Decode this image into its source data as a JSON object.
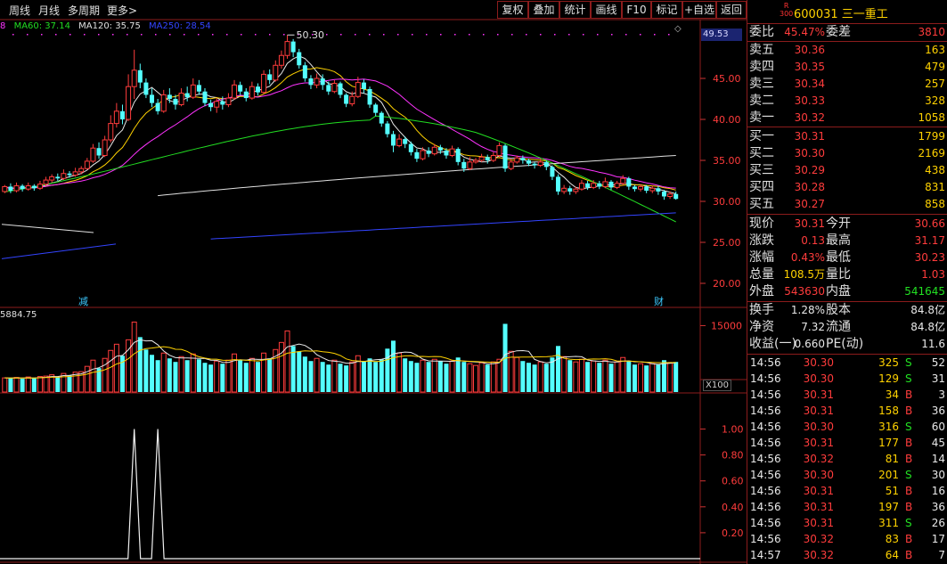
{
  "toolbar": {
    "left_items": [
      "周线",
      "月线",
      "多周期",
      "更多>"
    ],
    "buttons": [
      "复权",
      "叠加",
      "统计",
      "画线",
      "F10",
      "标记",
      "+自选",
      "返回"
    ]
  },
  "ma_legend": [
    {
      "text": "8",
      "color": "#ff33ff"
    },
    {
      "text": "MA60: 37.14",
      "color": "#22dd22"
    },
    {
      "text": "MA120: 35.75",
      "color": "#e0e0e0"
    },
    {
      "text": "MA250: 28.54",
      "color": "#3344ff"
    }
  ],
  "price_chart": {
    "current_price_badge": "49.53",
    "high_label": "50.30",
    "y_ticks": [
      "45.00",
      "40.00",
      "35.00",
      "30.00",
      "25.00",
      "20.00"
    ],
    "markers": [
      "减",
      "财"
    ]
  },
  "volume_chart": {
    "label": "5884.75",
    "y_tick": "15000",
    "unit": "X100"
  },
  "indicator_chart": {
    "y_ticks": [
      "1.00",
      "0.80",
      "0.60",
      "0.40",
      "0.20"
    ]
  },
  "quote_panel": {
    "r_badge": "R",
    "r_badge_sub": "300",
    "title": "600031 三一重工",
    "weibi": {
      "label": "委比",
      "value": "45.47%",
      "label2": "委差",
      "value2": "3810"
    },
    "asks": [
      {
        "label": "卖五",
        "price": "30.36",
        "vol": "163"
      },
      {
        "label": "卖四",
        "price": "30.35",
        "vol": "479"
      },
      {
        "label": "卖三",
        "price": "30.34",
        "vol": "257"
      },
      {
        "label": "卖二",
        "price": "30.33",
        "vol": "328"
      },
      {
        "label": "卖一",
        "price": "30.32",
        "vol": "1058"
      }
    ],
    "bids": [
      {
        "label": "买一",
        "price": "30.31",
        "vol": "1799"
      },
      {
        "label": "买二",
        "price": "30.30",
        "vol": "2169"
      },
      {
        "label": "买三",
        "price": "30.29",
        "vol": "438"
      },
      {
        "label": "买四",
        "price": "30.28",
        "vol": "831"
      },
      {
        "label": "买五",
        "price": "30.27",
        "vol": "858"
      }
    ],
    "stats": [
      {
        "l1": "现价",
        "v1": "30.31",
        "c1": "red",
        "l2": "今开",
        "v2": "30.66",
        "c2": "red"
      },
      {
        "l1": "涨跌",
        "v1": "0.13",
        "c1": "red",
        "l2": "最高",
        "v2": "31.17",
        "c2": "red"
      },
      {
        "l1": "涨幅",
        "v1": "0.43%",
        "c1": "red",
        "l2": "最低",
        "v2": "30.23",
        "c2": "red"
      },
      {
        "l1": "总量",
        "v1": "108.5万",
        "c1": "yellow",
        "l2": "量比",
        "v2": "1.03",
        "c2": "red"
      },
      {
        "l1": "外盘",
        "v1": "543630",
        "c1": "red",
        "l2": "内盘",
        "v2": "541645",
        "c2": "green"
      }
    ],
    "stats2": [
      {
        "l1": "换手",
        "v1": "1.28%",
        "c1": "white",
        "l2": "股本",
        "v2": "84.8亿",
        "c2": "white"
      },
      {
        "l1": "净资",
        "v1": "7.32",
        "c1": "white",
        "l2": "流通",
        "v2": "84.8亿",
        "c2": "white"
      },
      {
        "l1": "收益(一)",
        "v1": "0.660",
        "c1": "white",
        "l2": "PE(动)",
        "v2": "11.6",
        "c2": "white"
      }
    ],
    "ticks": [
      {
        "time": "14:56",
        "price": "30.30",
        "vol": "325",
        "bs": "S",
        "n": "52"
      },
      {
        "time": "14:56",
        "price": "30.30",
        "vol": "129",
        "bs": "S",
        "n": "31"
      },
      {
        "time": "14:56",
        "price": "30.31",
        "vol": "34",
        "bs": "B",
        "n": "3"
      },
      {
        "time": "14:56",
        "price": "30.31",
        "vol": "158",
        "bs": "B",
        "n": "36"
      },
      {
        "time": "14:56",
        "price": "30.30",
        "vol": "316",
        "bs": "S",
        "n": "60"
      },
      {
        "time": "14:56",
        "price": "30.31",
        "vol": "177",
        "bs": "B",
        "n": "45"
      },
      {
        "time": "14:56",
        "price": "30.32",
        "vol": "81",
        "bs": "B",
        "n": "14"
      },
      {
        "time": "14:56",
        "price": "30.30",
        "vol": "201",
        "bs": "S",
        "n": "30"
      },
      {
        "time": "14:56",
        "price": "30.31",
        "vol": "51",
        "bs": "B",
        "n": "16"
      },
      {
        "time": "14:56",
        "price": "30.31",
        "vol": "197",
        "bs": "B",
        "n": "36"
      },
      {
        "time": "14:56",
        "price": "30.31",
        "vol": "311",
        "bs": "S",
        "n": "26"
      },
      {
        "time": "14:56",
        "price": "30.32",
        "vol": "83",
        "bs": "B",
        "n": "17"
      },
      {
        "time": "14:57",
        "price": "30.32",
        "vol": "64",
        "bs": "B",
        "n": "7"
      }
    ]
  },
  "colors": {
    "up": "#ff3c3c",
    "down": "#54ffff",
    "ma5": "#e8e8e8",
    "ma10": "#ffd200",
    "ma20": "#ff33ff",
    "ma60": "#22dd22",
    "ma120": "#e0e0e0",
    "ma250": "#3344ff",
    "border": "#8b1c1c"
  },
  "chart_data": {
    "type": "candlestick",
    "price_y_ticks": [
      45,
      40,
      35,
      30,
      25,
      20
    ],
    "candles": [
      [
        31.2,
        31.8,
        31.0,
        32.0
      ],
      [
        31.8,
        31.3,
        31.0,
        32.2
      ],
      [
        31.3,
        31.9,
        31.1,
        32.3
      ],
      [
        31.9,
        31.5,
        31.2,
        32.1
      ],
      [
        31.5,
        31.9,
        31.3,
        32.3
      ],
      [
        31.9,
        31.6,
        31.3,
        32.1
      ],
      [
        31.6,
        32.1,
        31.4,
        32.5
      ],
      [
        32.1,
        32.6,
        31.9,
        33.0
      ],
      [
        32.6,
        33.0,
        32.3,
        33.3
      ],
      [
        33.0,
        32.8,
        32.5,
        33.4
      ],
      [
        32.8,
        33.4,
        32.6,
        33.9
      ],
      [
        33.4,
        33.2,
        32.9,
        33.7
      ],
      [
        33.2,
        33.6,
        33.0,
        34.1
      ],
      [
        33.6,
        34.0,
        33.3,
        34.3
      ],
      [
        34.0,
        34.9,
        33.9,
        35.3
      ],
      [
        34.9,
        36.5,
        34.7,
        37.0
      ],
      [
        36.5,
        35.6,
        35.2,
        37.2
      ],
      [
        35.6,
        37.5,
        35.4,
        38.0
      ],
      [
        37.5,
        39.5,
        37.2,
        40.5
      ],
      [
        39.5,
        41.0,
        39.0,
        42.0
      ],
      [
        41.0,
        40.0,
        39.4,
        41.8
      ],
      [
        40.0,
        44.0,
        39.8,
        45.5
      ],
      [
        44.0,
        46.0,
        42.5,
        48.5
      ],
      [
        46.0,
        44.5,
        43.8,
        46.8
      ],
      [
        44.5,
        43.0,
        42.6,
        45.0
      ],
      [
        43.0,
        42.0,
        41.5,
        43.8
      ],
      [
        42.0,
        41.0,
        40.6,
        42.5
      ],
      [
        41.0,
        43.0,
        40.8,
        43.6
      ],
      [
        43.0,
        42.5,
        42.0,
        43.8
      ],
      [
        42.5,
        41.8,
        41.2,
        43.0
      ],
      [
        41.8,
        43.2,
        41.6,
        43.8
      ],
      [
        43.2,
        42.7,
        42.2,
        44.0
      ],
      [
        42.7,
        44.2,
        42.5,
        45.0
      ],
      [
        44.2,
        43.4,
        43.0,
        44.8
      ],
      [
        43.4,
        42.0,
        41.6,
        43.8
      ],
      [
        42.0,
        41.5,
        41.0,
        42.4
      ],
      [
        41.5,
        42.2,
        40.8,
        42.6
      ],
      [
        42.2,
        41.8,
        41.2,
        42.8
      ],
      [
        41.8,
        42.6,
        41.5,
        43.2
      ],
      [
        42.6,
        44.2,
        42.4,
        44.8
      ],
      [
        44.2,
        43.4,
        43.0,
        44.6
      ],
      [
        43.4,
        42.6,
        42.2,
        43.8
      ],
      [
        42.6,
        44.0,
        42.4,
        44.6
      ],
      [
        44.0,
        43.3,
        42.9,
        44.4
      ],
      [
        43.3,
        45.5,
        43.1,
        46.0
      ],
      [
        45.5,
        44.8,
        44.3,
        46.1
      ],
      [
        44.8,
        46.6,
        44.6,
        47.2
      ],
      [
        46.6,
        47.8,
        46.2,
        48.4
      ],
      [
        47.8,
        49.5,
        47.4,
        50.3
      ],
      [
        49.5,
        48.2,
        47.6,
        49.8
      ],
      [
        48.2,
        46.6,
        46.2,
        48.6
      ],
      [
        46.6,
        45.0,
        44.6,
        47.0
      ],
      [
        45.0,
        44.2,
        43.7,
        45.4
      ],
      [
        44.2,
        45.0,
        43.8,
        45.6
      ],
      [
        45.0,
        44.2,
        43.6,
        45.5
      ],
      [
        44.2,
        43.4,
        43.0,
        44.6
      ],
      [
        43.4,
        44.4,
        43.2,
        44.8
      ],
      [
        44.4,
        43.0,
        42.6,
        44.6
      ],
      [
        43.0,
        41.9,
        41.5,
        43.2
      ],
      [
        41.9,
        42.8,
        41.6,
        43.4
      ],
      [
        42.8,
        44.5,
        42.6,
        45.2
      ],
      [
        44.5,
        43.7,
        43.2,
        44.9
      ],
      [
        43.7,
        41.8,
        41.4,
        44.0
      ],
      [
        41.8,
        40.8,
        40.4,
        42.0
      ],
      [
        40.8,
        39.5,
        39.1,
        41.0
      ],
      [
        39.5,
        38.2,
        37.8,
        39.8
      ],
      [
        38.2,
        36.8,
        36.0,
        38.6
      ],
      [
        36.8,
        37.6,
        36.6,
        38.2
      ],
      [
        37.6,
        37.0,
        36.5,
        37.9
      ],
      [
        37.0,
        36.0,
        35.6,
        37.3
      ],
      [
        36.0,
        35.2,
        34.8,
        36.4
      ],
      [
        35.2,
        36.2,
        35.0,
        36.6
      ],
      [
        36.2,
        35.8,
        35.4,
        36.6
      ],
      [
        35.8,
        36.6,
        35.6,
        37.0
      ],
      [
        36.6,
        36.2,
        35.8,
        36.9
      ],
      [
        36.2,
        35.6,
        35.2,
        36.5
      ],
      [
        35.6,
        36.4,
        35.4,
        36.8
      ],
      [
        36.4,
        34.8,
        34.4,
        36.6
      ],
      [
        34.8,
        34.0,
        33.6,
        35.2
      ],
      [
        34.0,
        34.8,
        33.8,
        35.4
      ],
      [
        34.8,
        35.0,
        34.6,
        35.3
      ],
      [
        35.0,
        35.4,
        34.8,
        35.8
      ],
      [
        35.4,
        35.0,
        34.6,
        35.7
      ],
      [
        35.0,
        35.6,
        34.8,
        36.0
      ],
      [
        35.6,
        36.8,
        35.4,
        37.2
      ],
      [
        36.8,
        34.0,
        33.6,
        37.0
      ],
      [
        34.0,
        34.8,
        33.8,
        35.2
      ],
      [
        34.8,
        35.3,
        34.6,
        35.6
      ],
      [
        35.3,
        35.0,
        34.6,
        35.6
      ],
      [
        35.0,
        34.6,
        34.3,
        35.2
      ],
      [
        34.6,
        34.4,
        34.0,
        34.8
      ],
      [
        34.4,
        34.8,
        34.2,
        35.2
      ],
      [
        34.8,
        34.2,
        33.8,
        35.0
      ],
      [
        34.2,
        33.0,
        32.6,
        34.4
      ],
      [
        33.0,
        31.2,
        30.8,
        33.3
      ],
      [
        31.2,
        31.6,
        30.9,
        32.0
      ],
      [
        31.6,
        31.2,
        30.8,
        31.9
      ],
      [
        31.2,
        31.5,
        30.9,
        31.8
      ],
      [
        31.5,
        32.2,
        31.3,
        32.6
      ],
      [
        32.2,
        31.7,
        31.4,
        32.5
      ],
      [
        31.7,
        32.2,
        31.5,
        32.6
      ],
      [
        32.2,
        31.8,
        31.5,
        32.5
      ],
      [
        31.8,
        32.4,
        31.6,
        32.9
      ],
      [
        32.4,
        31.7,
        31.4,
        32.6
      ],
      [
        31.7,
        32.2,
        31.5,
        32.5
      ],
      [
        32.2,
        32.8,
        32.0,
        33.2
      ],
      [
        32.8,
        31.8,
        31.4,
        33.0
      ],
      [
        31.8,
        31.5,
        31.2,
        32.0
      ],
      [
        31.5,
        31.8,
        31.2,
        32.1
      ],
      [
        31.8,
        31.3,
        31.0,
        32.0
      ],
      [
        31.3,
        31.6,
        31.0,
        31.9
      ],
      [
        31.6,
        31.2,
        30.8,
        31.9
      ],
      [
        31.2,
        30.6,
        30.2,
        31.4
      ],
      [
        30.6,
        30.9,
        30.3,
        31.2
      ],
      [
        30.9,
        30.3,
        30.2,
        31.2
      ]
    ],
    "volumes": [
      3200,
      3100,
      3300,
      3000,
      3400,
      3100,
      3500,
      3600,
      3900,
      3400,
      4200,
      3800,
      4500,
      4600,
      5800,
      7200,
      5400,
      7600,
      9400,
      10800,
      8200,
      11800,
      15800,
      12400,
      9600,
      8400,
      7200,
      8800,
      7600,
      6800,
      8000,
      7200,
      8600,
      7400,
      6600,
      6200,
      7000,
      6400,
      7200,
      8600,
      7200,
      6600,
      7600,
      6800,
      8800,
      7600,
      9600,
      11200,
      13800,
      10400,
      9200,
      8000,
      7000,
      7600,
      6800,
      6200,
      7200,
      6400,
      6000,
      6800,
      8200,
      7000,
      7600,
      6800,
      7400,
      9800,
      11600,
      8800,
      7600,
      7000,
      6600,
      7200,
      6800,
      7400,
      7000,
      6400,
      7000,
      7800,
      6800,
      6400,
      6000,
      6600,
      6200,
      6800,
      7400,
      15400,
      9200,
      7800,
      7000,
      6600,
      6200,
      6800,
      6400,
      7800,
      10400,
      8000,
      7200,
      6800,
      7400,
      6800,
      7000,
      6600,
      7200,
      6400,
      6800,
      7800,
      7000,
      6200,
      6400,
      6000,
      6400,
      6200,
      7200,
      6600,
      6800
    ],
    "volume_ylim": [
      0,
      16500
    ],
    "indicator_ylim": [
      0,
      1.1
    ],
    "indicator_spikes": [
      22,
      26
    ]
  }
}
